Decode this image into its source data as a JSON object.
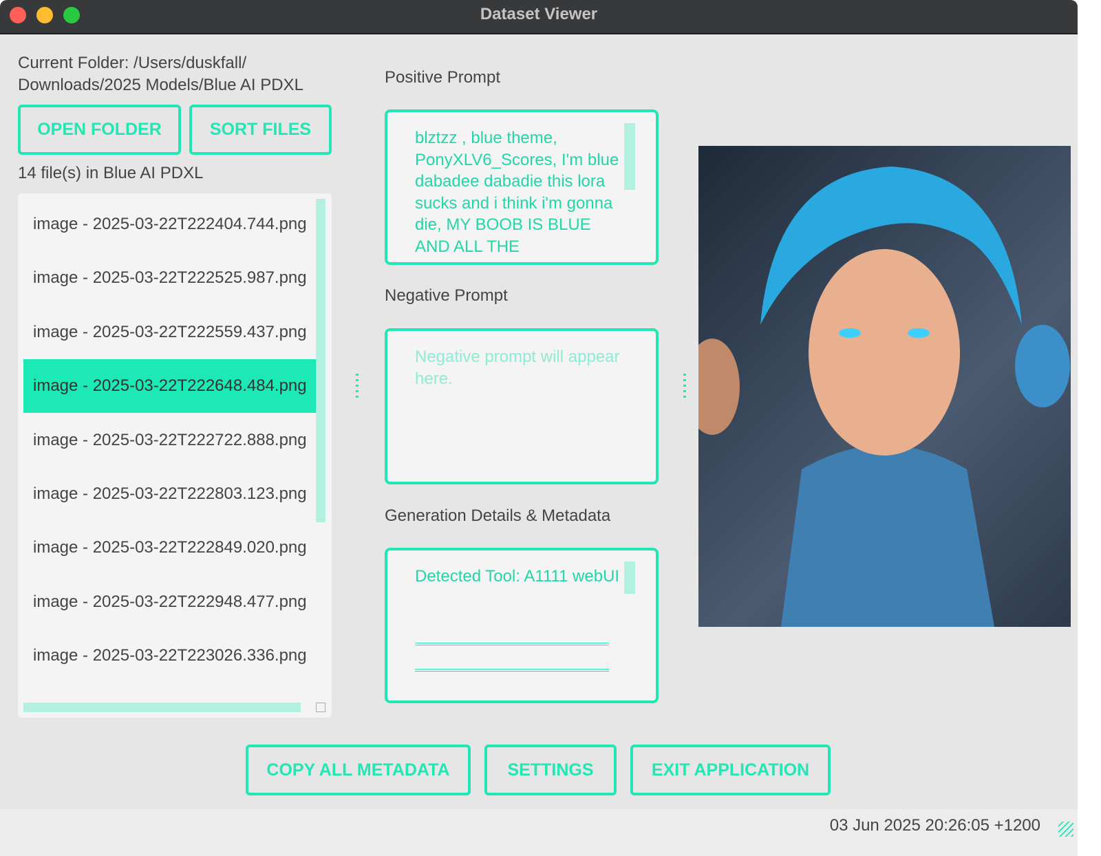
{
  "window": {
    "title": "Dataset Viewer"
  },
  "left": {
    "current_folder": "Current Folder: /Users/duskfall/\nDownloads/2025 Models/Blue AI PDXL",
    "open_folder": "OPEN FOLDER",
    "sort_files": "SORT FILES",
    "file_count": "14 file(s) in Blue AI PDXL",
    "files": [
      "image - 2025-03-22T222404.744.png",
      "image - 2025-03-22T222525.987.png",
      "image - 2025-03-22T222559.437.png",
      "image - 2025-03-22T222648.484.png",
      "image - 2025-03-22T222722.888.png",
      "image - 2025-03-22T222803.123.png",
      "image - 2025-03-22T222849.020.png",
      "image - 2025-03-22T222948.477.png",
      "image - 2025-03-22T223026.336.png"
    ],
    "selected_index": 3
  },
  "middle": {
    "positive_label": "Positive Prompt",
    "positive_text": "blztzz , blue theme, PonyXLV6_Scores, I'm blue dabadee dabadie this lora sucks and i think i'm gonna die, MY BOOB IS BLUE AND ALL THE",
    "negative_label": "Negative Prompt",
    "negative_placeholder": "Negative prompt will appear here.",
    "details_label": "Generation Details & Metadata",
    "details_text": "Detected Tool: A1111 webUI"
  },
  "bottom": {
    "copy": "COPY ALL METADATA",
    "settings": "SETTINGS",
    "exit": "EXIT APPLICATION"
  },
  "status": {
    "timestamp": "03 Jun 2025 20:26:05 +1200"
  },
  "colors": {
    "accent": "#22e6b4",
    "selected": "#1de9b6"
  }
}
